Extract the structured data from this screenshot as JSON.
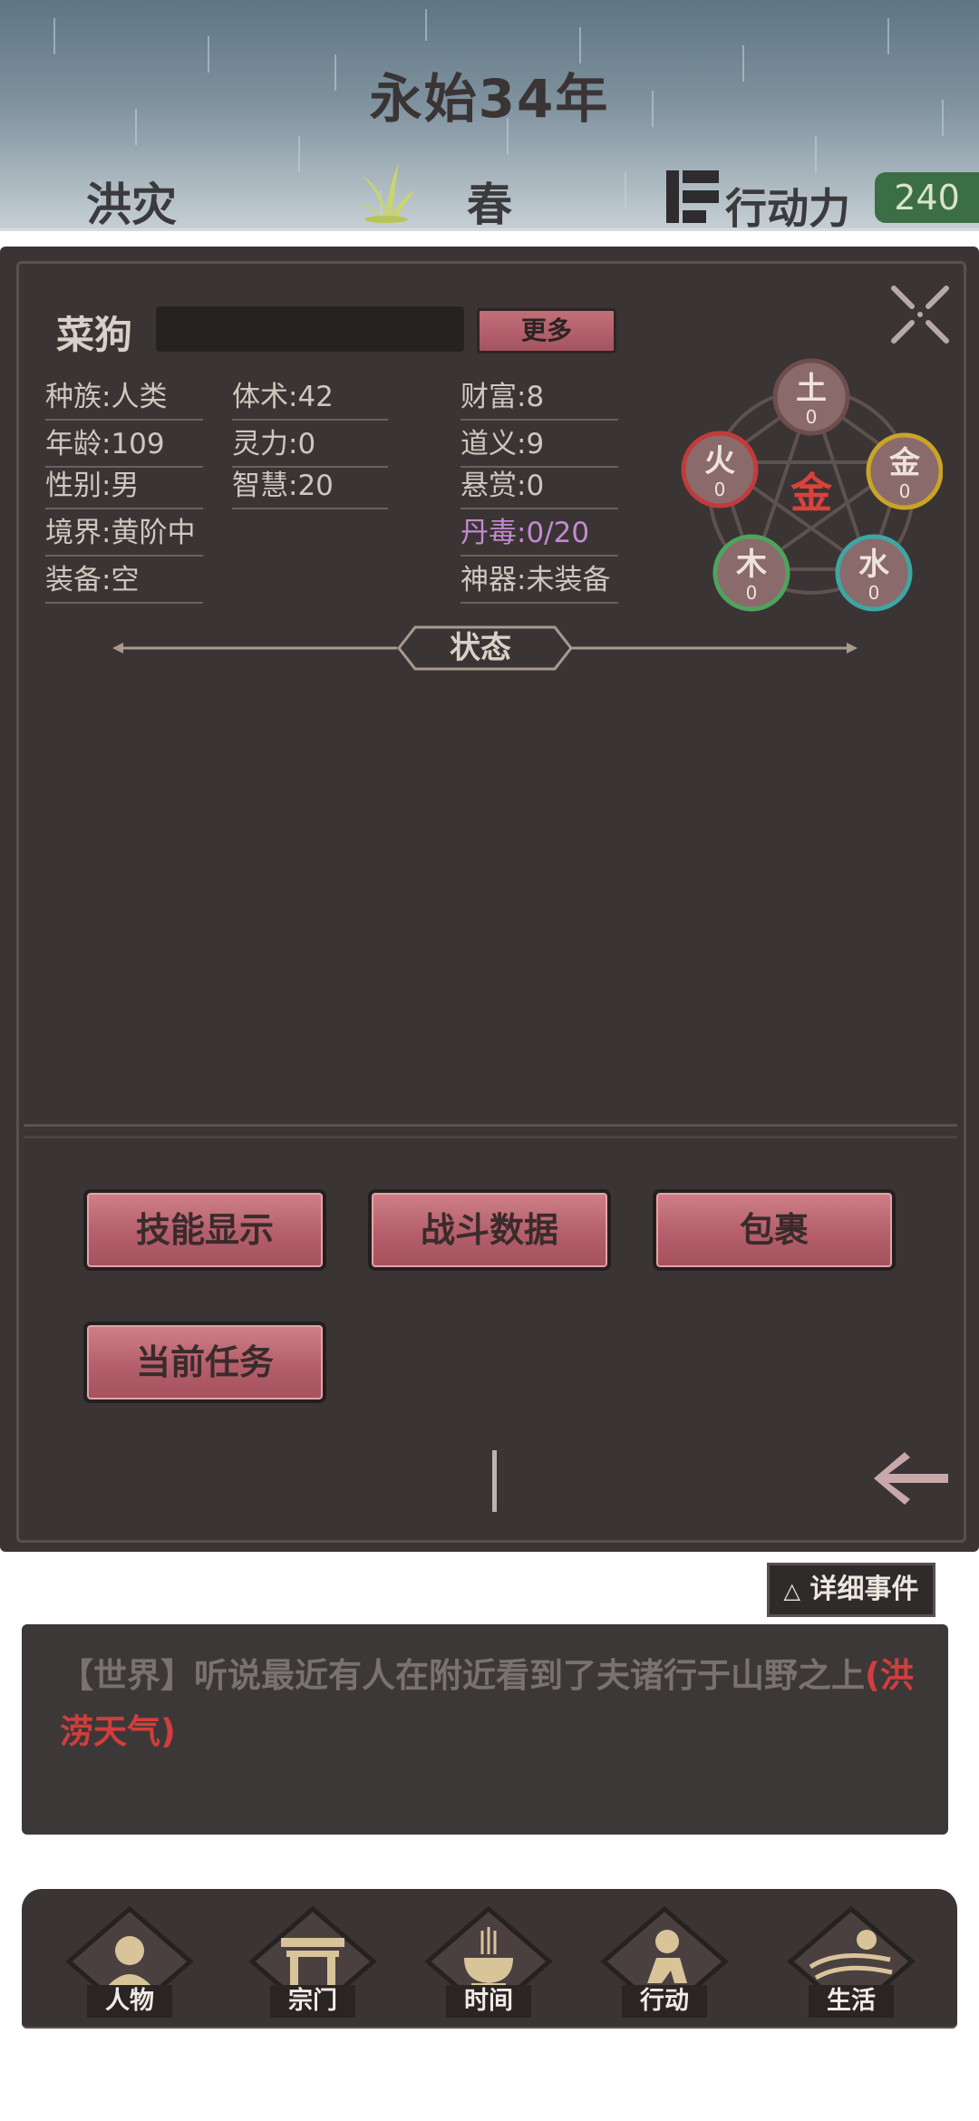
{
  "header": {
    "year_title": "永始34年",
    "weather": "洪灾",
    "season": "春",
    "action_label": "行动力",
    "action_value": "240"
  },
  "character": {
    "name": "菜狗",
    "more_label": "更多",
    "stats": {
      "race": "种族:人类",
      "age": "年龄:109",
      "gender": "性别:男",
      "realm": "境界:黄阶中",
      "equipment": "装备:空",
      "body": "体术:42",
      "spirit": "灵力:0",
      "wisdom": "智慧:20",
      "wealth": "财富:8",
      "morality": "道义:9",
      "bounty": "悬赏:0",
      "pill_poison": "丹毒:0/20",
      "artifact": "神器:未装备"
    },
    "wuxing": {
      "center": "金",
      "elements": [
        {
          "name": "土",
          "value": "0",
          "color": "#8b5e5e"
        },
        {
          "name": "金",
          "value": "0",
          "color": "#c9a427"
        },
        {
          "name": "水",
          "value": "0",
          "color": "#3fa5a5"
        },
        {
          "name": "木",
          "value": "0",
          "color": "#4fa35c"
        },
        {
          "name": "火",
          "value": "0",
          "color": "#c23b3b"
        }
      ]
    }
  },
  "status_label": "状态",
  "buttons": {
    "skills": "技能显示",
    "battle": "战斗数据",
    "bag": "包裹",
    "quest": "当前任务"
  },
  "events": {
    "detail_label": "详细事件",
    "detail_icon": "△",
    "log_prefix": "【世界】听说最近有人在附近看到了夫诸行于山野之上",
    "log_highlight": "(洪涝天气)"
  },
  "nav": [
    {
      "label": "人物",
      "icon": "person-icon"
    },
    {
      "label": "宗门",
      "icon": "sect-gate-icon"
    },
    {
      "label": "时间",
      "icon": "incense-burner-icon"
    },
    {
      "label": "行动",
      "icon": "action-figure-icon"
    },
    {
      "label": "生活",
      "icon": "life-landscape-icon"
    }
  ]
}
